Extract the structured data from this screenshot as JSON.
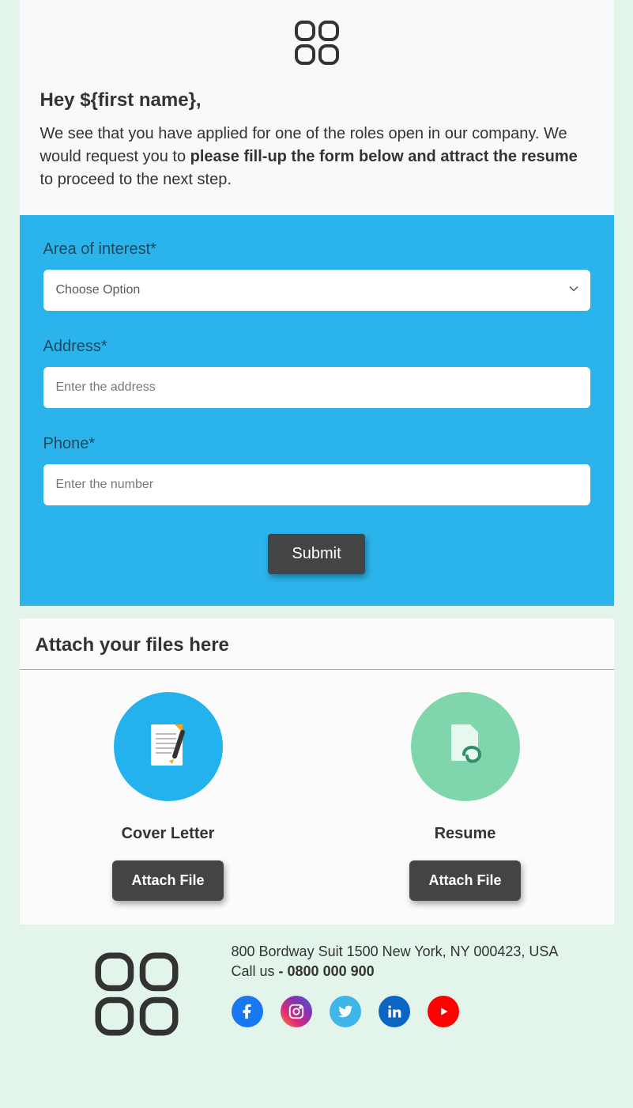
{
  "header": {
    "greeting": "Hey ${first name},",
    "intro_before": "We see that you have applied for one of the roles open in our company. We would request you to ",
    "intro_bold": "please fill-up the form below and attract the resume",
    "intro_after": " to proceed to the next step."
  },
  "form": {
    "area_label": "Area of interest*",
    "area_selected": "Choose Option",
    "address_label": "Address*",
    "address_placeholder": "Enter the address",
    "phone_label": "Phone*",
    "phone_placeholder": "Enter the number",
    "submit_label": "Submit"
  },
  "attach": {
    "heading": "Attach your files here",
    "cover_title": "Cover Letter",
    "cover_button": "Attach File",
    "resume_title": "Resume",
    "resume_button": "Attach File"
  },
  "footer": {
    "address": "800 Bordway Suit 1500 New York, NY 000423, USA",
    "call_prefix": "Call us ",
    "call_number": "- 0800 000 900"
  },
  "colors": {
    "form_bg": "#2bb4ec",
    "page_bg": "#e3f5ea",
    "button_bg": "#444444"
  }
}
